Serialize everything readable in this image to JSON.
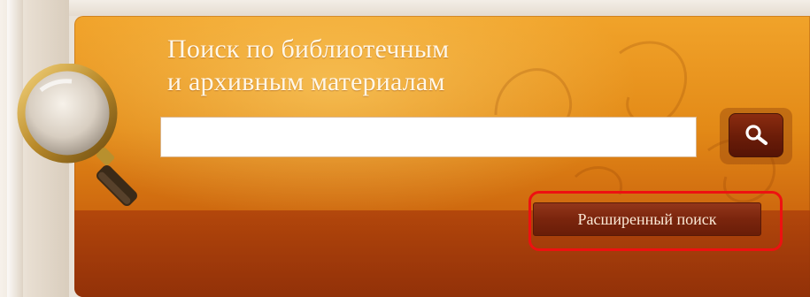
{
  "search_panel": {
    "title_line1": "Поиск по библиотечным",
    "title_line2": "и архивным материалам",
    "search_input": {
      "value": "",
      "placeholder": ""
    },
    "search_button_icon": "magnifier-icon",
    "advanced_search_label": "Расширенный поиск"
  },
  "colors": {
    "panel_orange": "#e38a17",
    "panel_dark": "#b5480b",
    "button_brown": "#7a250d",
    "highlight_red": "#ee1111",
    "title_text": "#fff7e8"
  },
  "decorations": {
    "magnifier_graphic": "magnifying-glass-icon",
    "highlight_box": "red-rounded-rectangle"
  }
}
